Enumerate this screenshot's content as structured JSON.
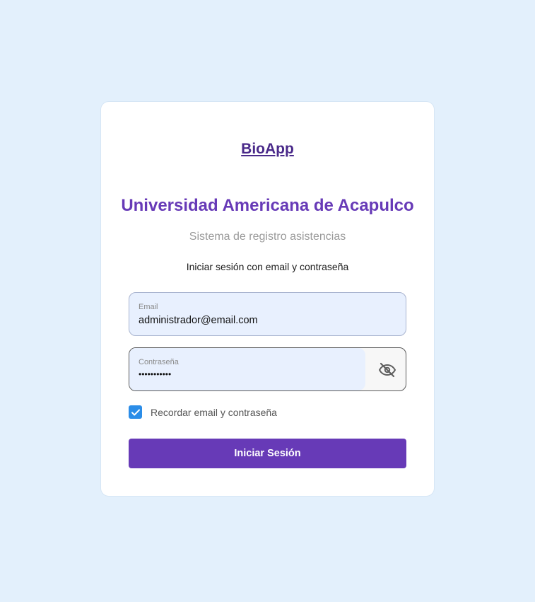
{
  "brand": {
    "name": "BioApp"
  },
  "header": {
    "title": "Universidad Americana de Acapulco",
    "subtitle": "Sistema de registro asistencias",
    "instruction": "Iniciar sesión con email y contraseña"
  },
  "form": {
    "email": {
      "label": "Email",
      "value": "administrador@email.com"
    },
    "password": {
      "label": "Contraseña",
      "value": "•••••••••••",
      "toggle_icon": "eye-off-icon"
    },
    "remember": {
      "label": "Recordar email y contraseña",
      "checked": true
    },
    "submit_label": "Iniciar Sesión"
  },
  "colors": {
    "background": "#e3f0fc",
    "primary": "#673ab7",
    "brand": "#4a2a8a",
    "checkbox": "#2b8de8",
    "field_fill": "#e8f0fe"
  }
}
